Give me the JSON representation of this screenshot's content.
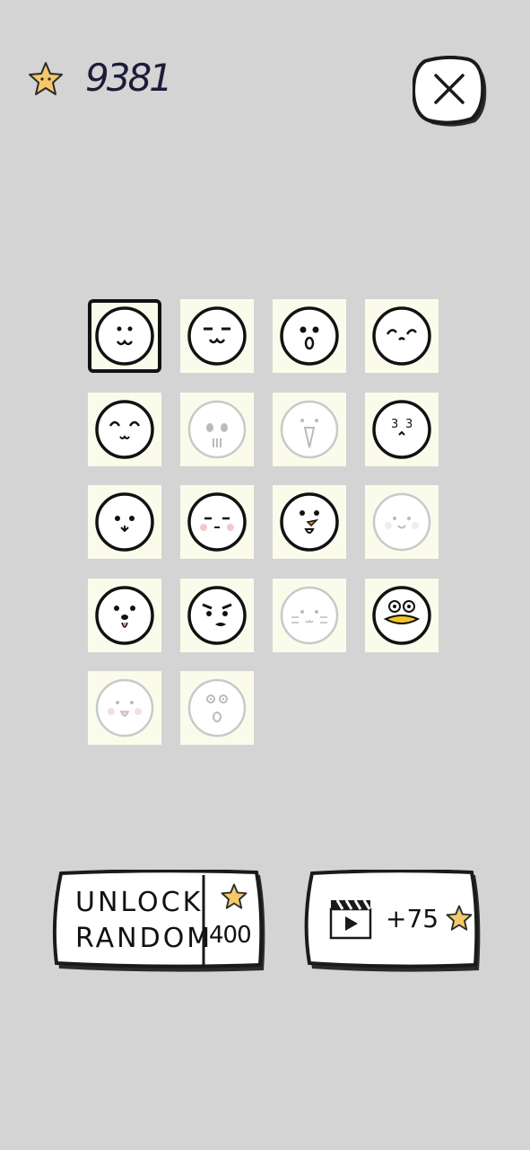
{
  "header": {
    "score": "9381",
    "star_icon": "star-icon",
    "close_icon": "close-icon"
  },
  "faces": [
    {
      "id": "face-1",
      "unlocked": true,
      "selected": true
    },
    {
      "id": "face-2",
      "unlocked": true
    },
    {
      "id": "face-3",
      "unlocked": true
    },
    {
      "id": "face-4",
      "unlocked": true
    },
    {
      "id": "face-5",
      "unlocked": true
    },
    {
      "id": "face-6",
      "unlocked": false
    },
    {
      "id": "face-7",
      "unlocked": false
    },
    {
      "id": "face-8",
      "unlocked": true
    },
    {
      "id": "face-9",
      "unlocked": true
    },
    {
      "id": "face-10",
      "unlocked": true
    },
    {
      "id": "face-11",
      "unlocked": true
    },
    {
      "id": "face-12",
      "unlocked": false
    },
    {
      "id": "face-13",
      "unlocked": true
    },
    {
      "id": "face-14",
      "unlocked": true
    },
    {
      "id": "face-15",
      "unlocked": false
    },
    {
      "id": "face-16",
      "unlocked": true
    },
    {
      "id": "face-17",
      "unlocked": false
    },
    {
      "id": "face-18",
      "unlocked": false
    }
  ],
  "unlock": {
    "line1": "UNLOCK",
    "line2": "RANDOM",
    "cost": "400"
  },
  "video_reward": {
    "label": "+75",
    "icon": "clapperboard-icon"
  },
  "colors": {
    "background": "#d4d4d4",
    "tile": "#fbfbec",
    "star": "#f5c96a",
    "duck_beak": "#f3c623"
  }
}
